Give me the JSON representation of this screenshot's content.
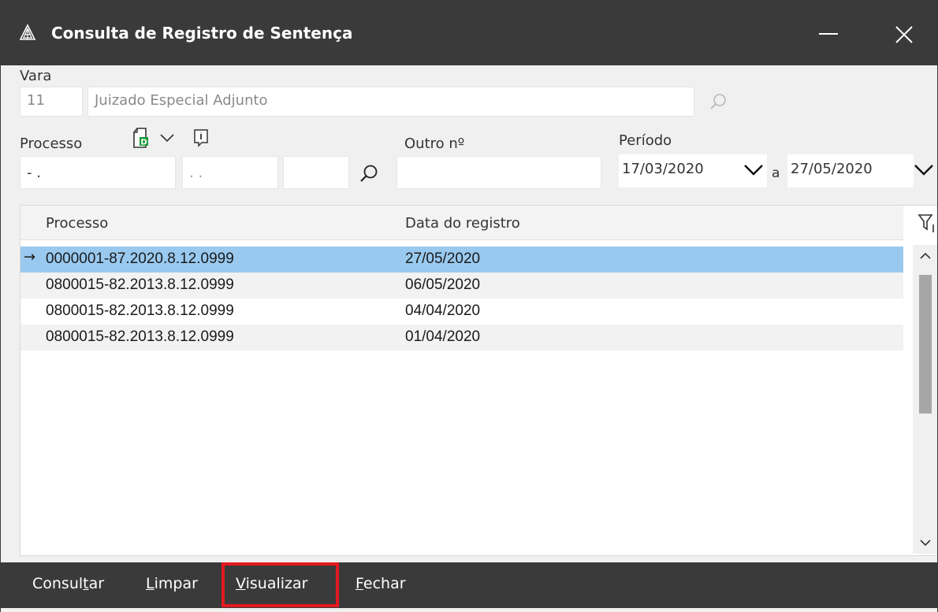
{
  "window": {
    "title": "Consulta de Registro de Sentença",
    "icons": {
      "app": "tree-logo-icon",
      "minimize": "minimize-icon",
      "close": "close-icon"
    }
  },
  "vara": {
    "label": "Vara",
    "code": "11",
    "name": "Juizado Especial Adjunto"
  },
  "processo": {
    "label": "Processo",
    "part1": "- .",
    "part2": ". .",
    "part3": ""
  },
  "outro": {
    "label": "Outro nº",
    "value": ""
  },
  "periodo": {
    "label": "Período",
    "from": "17/03/2020",
    "separator": "a",
    "to": "27/05/2020"
  },
  "grid": {
    "columns": [
      "Processo",
      "Data do registro"
    ],
    "rows": [
      {
        "processo": "0000001-87.2020.8.12.0999",
        "data": "27/05/2020"
      },
      {
        "processo": "0800015-82.2013.8.12.0999",
        "data": "06/05/2020"
      },
      {
        "processo": "0800015-82.2013.8.12.0999",
        "data": "04/04/2020"
      },
      {
        "processo": "0800015-82.2013.8.12.0999",
        "data": "01/04/2020"
      }
    ],
    "current_row_marker": "→"
  },
  "toolbar": {
    "consultar": {
      "before": "Consul",
      "underlined": "t",
      "after": "ar"
    },
    "limpar": {
      "before": "",
      "underlined": "L",
      "after": "impar"
    },
    "visualizar": {
      "before": "",
      "underlined": "V",
      "after": "isualizar"
    },
    "fechar": {
      "before": "",
      "underlined": "F",
      "after": "echar"
    }
  },
  "colors": {
    "titlebar": "#3a3a3a",
    "selected_row": "#99c9ef",
    "highlight": "#e3191f",
    "doc_icon_green": "#1a9c3a"
  }
}
